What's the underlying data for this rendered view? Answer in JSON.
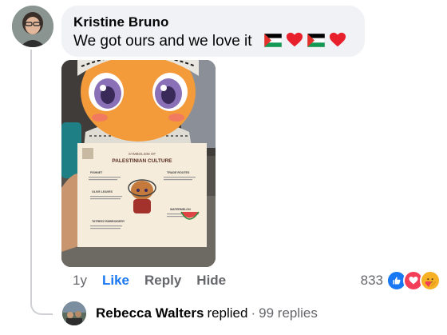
{
  "comment": {
    "author": "Kristine Bruno",
    "text": "We got ours and we love it",
    "emojis": [
      "palestine-flag",
      "red-heart",
      "palestine-flag",
      "red-heart"
    ]
  },
  "photo": {
    "card_heading_small": "SYMBOLISM OF",
    "card_heading": "PALESTINIAN CULTURE",
    "card_labels": [
      "FISHNET",
      "TRADE ROUTES",
      "OLIVE LEAVES",
      "WATERMELON",
      "TATREEZ EMBROIDERY"
    ]
  },
  "actions": {
    "time": "1y",
    "like": "Like",
    "reply": "Reply",
    "hide": "Hide"
  },
  "reactions": {
    "count": "833",
    "types": [
      "like",
      "love",
      "care"
    ],
    "colors": {
      "like": "#1877f2",
      "love": "#f33e58",
      "care": "#f7b125"
    }
  },
  "reply_summary": {
    "name": "Rebecca Walters",
    "verb": "replied",
    "separator": "·",
    "count": "99 replies"
  }
}
